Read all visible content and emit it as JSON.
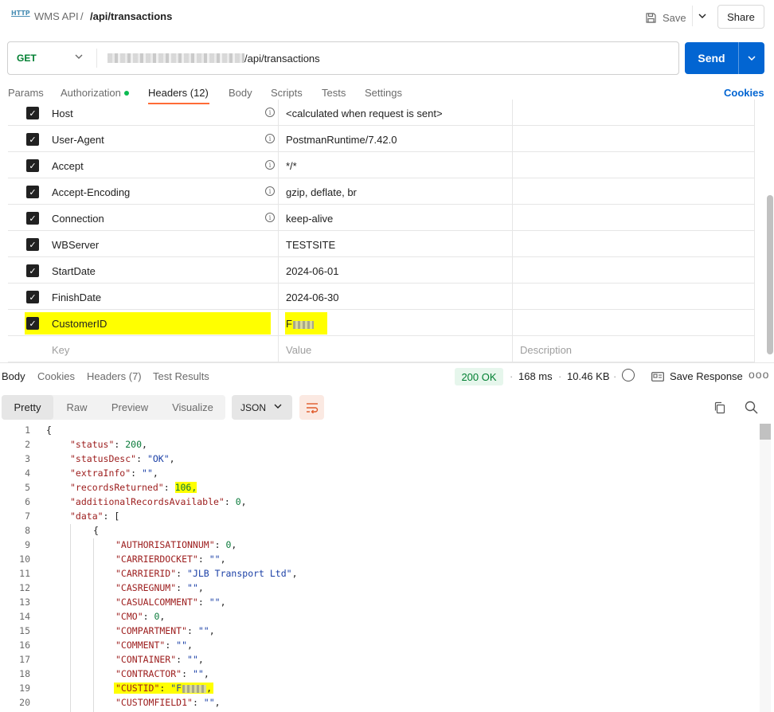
{
  "breadcrumb": {
    "parent": "WMS API",
    "separator": "/",
    "current": "/api/transactions",
    "icon_text": "HTTP"
  },
  "toolbar": {
    "save_label": "Save",
    "share_label": "Share"
  },
  "request": {
    "method": "GET",
    "url_path": "/api/transactions",
    "send_label": "Send"
  },
  "req_tabs": {
    "params": "Params",
    "authorization": "Authorization",
    "headers": "Headers (12)",
    "body": "Body",
    "scripts": "Scripts",
    "tests": "Tests",
    "settings": "Settings",
    "cookies": "Cookies"
  },
  "headers": {
    "rows": [
      {
        "key": "Host",
        "value": "<calculated when request is sent>"
      },
      {
        "key": "User-Agent",
        "value": "PostmanRuntime/7.42.0"
      },
      {
        "key": "Accept",
        "value": "*/*"
      },
      {
        "key": "Accept-Encoding",
        "value": "gzip, deflate, br"
      },
      {
        "key": "Connection",
        "value": "keep-alive"
      },
      {
        "key": "WBServer",
        "value": "TESTSITE"
      },
      {
        "key": "StartDate",
        "value": "2024-06-01"
      },
      {
        "key": "FinishDate",
        "value": "2024-06-30"
      },
      {
        "key": "CustomerID",
        "value": "F"
      }
    ],
    "placeholder": {
      "key": "Key",
      "value": "Value",
      "description": "Description"
    }
  },
  "response": {
    "tabs": {
      "body": "Body",
      "cookies": "Cookies",
      "headers": "Headers (7)",
      "test_results": "Test Results"
    },
    "status": "200 OK",
    "time": "168 ms",
    "size": "10.46 KB",
    "save_response": "Save Response",
    "more": "ooo",
    "views": {
      "pretty": "Pretty",
      "raw": "Raw",
      "preview": "Preview",
      "visualize": "Visualize"
    },
    "format": "JSON"
  },
  "code": {
    "line_numbers": [
      "1",
      "2",
      "3",
      "4",
      "5",
      "6",
      "7",
      "8",
      "9",
      "10",
      "11",
      "12",
      "13",
      "14",
      "15",
      "16",
      "17",
      "18",
      "19",
      "20"
    ],
    "open_brace": "{",
    "status_key": "\"status\"",
    "status_val": "200",
    "statusDesc_key": "\"statusDesc\"",
    "statusDesc_val": "\"OK\"",
    "extraInfo_key": "\"extraInfo\"",
    "extraInfo_val": "\"\"",
    "recordsReturned_key": "\"recordsReturned\"",
    "recordsReturned_val": "106,",
    "additional_key": "\"additionalRecordsAvailable\"",
    "additional_val": "0",
    "data_key": "\"data\"",
    "data_open": "[",
    "item_open": "{",
    "f1_key": "\"AUTHORISATIONNUM\"",
    "f1_val": "0",
    "f2_key": "\"CARRIERDOCKET\"",
    "f2_val": "\"\"",
    "f3_key": "\"CARRIERID\"",
    "f3_val": "\"JLB Transport Ltd\"",
    "f4_key": "\"CASREGNUM\"",
    "f4_val": "\"\"",
    "f5_key": "\"CASUALCOMMENT\"",
    "f5_val": "\"\"",
    "f6_key": "\"CMO\"",
    "f6_val": "0",
    "f7_key": "\"COMPARTMENT\"",
    "f7_val": "\"\"",
    "f8_key": "\"COMMENT\"",
    "f8_val": "\"\"",
    "f9_key": "\"CONTAINER\"",
    "f9_val": "\"\"",
    "f10_key": "\"CONTRACTOR\"",
    "f10_val": "\"\"",
    "f11_key": "\"CUSTID\"",
    "f11_val": "\"F",
    "f12_key": "\"CUSTOMFIELD1\"",
    "f12_val": "\"\""
  },
  "colors": {
    "accent": "#0265d2",
    "tab_indicator": "#ff6c37",
    "status_ok": "#007f31",
    "highlight": "#ffff00"
  }
}
